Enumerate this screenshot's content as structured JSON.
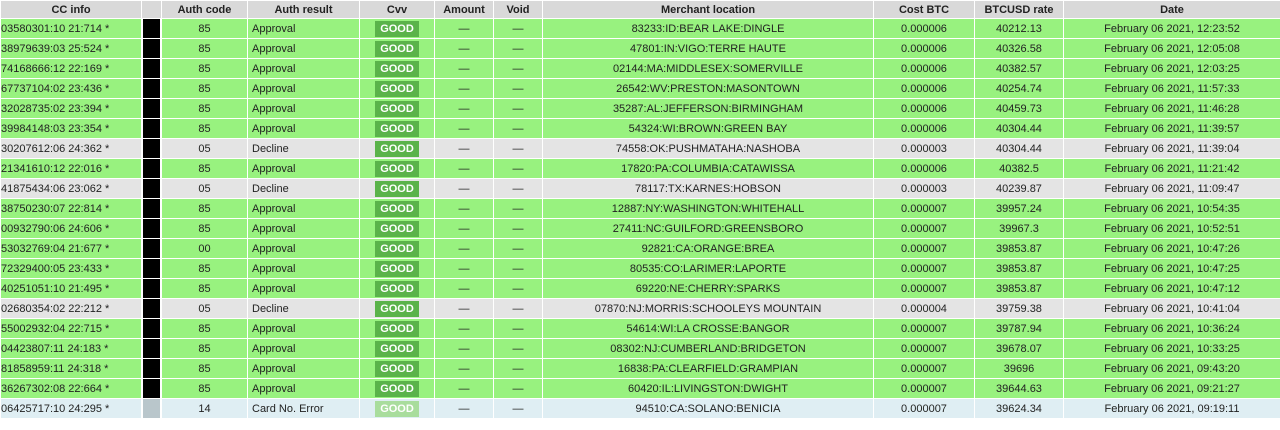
{
  "headers": {
    "cc_info": "CC info",
    "mask": "",
    "auth_code": "Auth code",
    "auth_result": "Auth result",
    "cvv": "Cvv",
    "amount": "Amount",
    "void": "Void",
    "merchant_location": "Merchant location",
    "cost_btc": "Cost BTC",
    "btcusd_rate": "BTCUSD rate",
    "date": "Date"
  },
  "rows": [
    {
      "status": "approve",
      "cc": "03580301:10 21:714",
      "star": "*",
      "auth_code": "85",
      "auth_result": "Approval",
      "cvv": "GOOD",
      "amount": "—",
      "void": "—",
      "merchant": "83233:ID:BEAR LAKE:DINGLE",
      "cost": "0.000006",
      "rate": "40212.13",
      "date": "February 06 2021, 12:23:52"
    },
    {
      "status": "approve",
      "cc": "38979639:03 25:524",
      "star": "*",
      "auth_code": "85",
      "auth_result": "Approval",
      "cvv": "GOOD",
      "amount": "—",
      "void": "—",
      "merchant": "47801:IN:VIGO:TERRE HAUTE",
      "cost": "0.000006",
      "rate": "40326.58",
      "date": "February 06 2021, 12:05:08"
    },
    {
      "status": "approve",
      "cc": "74168666:12 22:169",
      "star": "*",
      "auth_code": "85",
      "auth_result": "Approval",
      "cvv": "GOOD",
      "amount": "—",
      "void": "—",
      "merchant": "02144:MA:MIDDLESEX:SOMERVILLE",
      "cost": "0.000006",
      "rate": "40382.57",
      "date": "February 06 2021, 12:03:25"
    },
    {
      "status": "approve",
      "cc": "67737104:02 23:436",
      "star": "*",
      "auth_code": "85",
      "auth_result": "Approval",
      "cvv": "GOOD",
      "amount": "—",
      "void": "—",
      "merchant": "26542:WV:PRESTON:MASONTOWN",
      "cost": "0.000006",
      "rate": "40254.74",
      "date": "February 06 2021, 11:57:33"
    },
    {
      "status": "approve",
      "cc": "32028735:02 23:394",
      "star": "*",
      "auth_code": "85",
      "auth_result": "Approval",
      "cvv": "GOOD",
      "amount": "—",
      "void": "—",
      "merchant": "35287:AL:JEFFERSON:BIRMINGHAM",
      "cost": "0.000006",
      "rate": "40459.73",
      "date": "February 06 2021, 11:46:28"
    },
    {
      "status": "approve",
      "cc": "39984148:03 23:354",
      "star": "*",
      "auth_code": "85",
      "auth_result": "Approval",
      "cvv": "GOOD",
      "amount": "—",
      "void": "—",
      "merchant": "54324:WI:BROWN:GREEN BAY",
      "cost": "0.000006",
      "rate": "40304.44",
      "date": "February 06 2021, 11:39:57"
    },
    {
      "status": "decline",
      "cc": "30207612:06 24:362",
      "star": "*",
      "auth_code": "05",
      "auth_result": "Decline",
      "cvv": "GOOD",
      "amount": "—",
      "void": "—",
      "merchant": "74558:OK:PUSHMATAHA:NASHOBA",
      "cost": "0.000003",
      "rate": "40304.44",
      "date": "February 06 2021, 11:39:04"
    },
    {
      "status": "approve",
      "cc": "21341610:12 22:016",
      "star": "*",
      "auth_code": "85",
      "auth_result": "Approval",
      "cvv": "GOOD",
      "amount": "—",
      "void": "—",
      "merchant": "17820:PA:COLUMBIA:CATAWISSA",
      "cost": "0.000006",
      "rate": "40382.5",
      "date": "February 06 2021, 11:21:42"
    },
    {
      "status": "decline",
      "cc": "41875434:06 23:062",
      "star": "*",
      "auth_code": "05",
      "auth_result": "Decline",
      "cvv": "GOOD",
      "amount": "—",
      "void": "—",
      "merchant": "78117:TX:KARNES:HOBSON",
      "cost": "0.000003",
      "rate": "40239.87",
      "date": "February 06 2021, 11:09:47"
    },
    {
      "status": "approve",
      "cc": "38750230:07 22:814",
      "star": "*",
      "auth_code": "85",
      "auth_result": "Approval",
      "cvv": "GOOD",
      "amount": "—",
      "void": "—",
      "merchant": "12887:NY:WASHINGTON:WHITEHALL",
      "cost": "0.000007",
      "rate": "39957.24",
      "date": "February 06 2021, 10:54:35"
    },
    {
      "status": "approve",
      "cc": "00932790:06 24:606",
      "star": "*",
      "auth_code": "85",
      "auth_result": "Approval",
      "cvv": "GOOD",
      "amount": "—",
      "void": "—",
      "merchant": "27411:NC:GUILFORD:GREENSBORO",
      "cost": "0.000007",
      "rate": "39967.3",
      "date": "February 06 2021, 10:52:51"
    },
    {
      "status": "approve",
      "cc": "53032769:04 21:677",
      "star": "*",
      "auth_code": "00",
      "auth_result": "Approval",
      "cvv": "GOOD",
      "amount": "—",
      "void": "—",
      "merchant": "92821:CA:ORANGE:BREA",
      "cost": "0.000007",
      "rate": "39853.87",
      "date": "February 06 2021, 10:47:26"
    },
    {
      "status": "approve",
      "cc": "72329400:05 23:433",
      "star": "*",
      "auth_code": "85",
      "auth_result": "Approval",
      "cvv": "GOOD",
      "amount": "—",
      "void": "—",
      "merchant": "80535:CO:LARIMER:LAPORTE",
      "cost": "0.000007",
      "rate": "39853.87",
      "date": "February 06 2021, 10:47:25"
    },
    {
      "status": "approve",
      "cc": "40251051:10 21:495",
      "star": "*",
      "auth_code": "85",
      "auth_result": "Approval",
      "cvv": "GOOD",
      "amount": "—",
      "void": "—",
      "merchant": "69220:NE:CHERRY:SPARKS",
      "cost": "0.000007",
      "rate": "39853.87",
      "date": "February 06 2021, 10:47:12"
    },
    {
      "status": "decline",
      "cc": "02680354:02 22:212",
      "star": "*",
      "auth_code": "05",
      "auth_result": "Decline",
      "cvv": "GOOD",
      "amount": "—",
      "void": "—",
      "merchant": "07870:NJ:MORRIS:SCHOOLEYS MOUNTAIN",
      "cost": "0.000004",
      "rate": "39759.38",
      "date": "February 06 2021, 10:41:04"
    },
    {
      "status": "approve",
      "cc": "55002932:04 22:715",
      "star": "*",
      "auth_code": "85",
      "auth_result": "Approval",
      "cvv": "GOOD",
      "amount": "—",
      "void": "—",
      "merchant": "54614:WI:LA CROSSE:BANGOR",
      "cost": "0.000007",
      "rate": "39787.94",
      "date": "February 06 2021, 10:36:24"
    },
    {
      "status": "approve",
      "cc": "04423807:11 24:183",
      "star": "*",
      "auth_code": "85",
      "auth_result": "Approval",
      "cvv": "GOOD",
      "amount": "—",
      "void": "—",
      "merchant": "08302:NJ:CUMBERLAND:BRIDGETON",
      "cost": "0.000007",
      "rate": "39678.07",
      "date": "February 06 2021, 10:33:25"
    },
    {
      "status": "approve",
      "cc": "81858959:11 24:318",
      "star": "*",
      "auth_code": "85",
      "auth_result": "Approval",
      "cvv": "GOOD",
      "amount": "—",
      "void": "—",
      "merchant": "16838:PA:CLEARFIELD:GRAMPIAN",
      "cost": "0.000007",
      "rate": "39696",
      "date": "February 06 2021, 09:43:20"
    },
    {
      "status": "approve",
      "cc": "36267302:08 22:664",
      "star": "*",
      "auth_code": "85",
      "auth_result": "Approval",
      "cvv": "GOOD",
      "amount": "—",
      "void": "—",
      "merchant": "60420:IL:LIVINGSTON:DWIGHT",
      "cost": "0.000007",
      "rate": "39644.63",
      "date": "February 06 2021, 09:21:27"
    },
    {
      "status": "error",
      "cc": "06425717:10 24:295",
      "star": "*",
      "auth_code": "14",
      "auth_result": "Card No. Error",
      "cvv": "GOOD",
      "amount": "—",
      "void": "—",
      "merchant": "94510:CA:SOLANO:BENICIA",
      "cost": "0.000007",
      "rate": "39624.34",
      "date": "February 06 2021, 09:19:11"
    }
  ]
}
